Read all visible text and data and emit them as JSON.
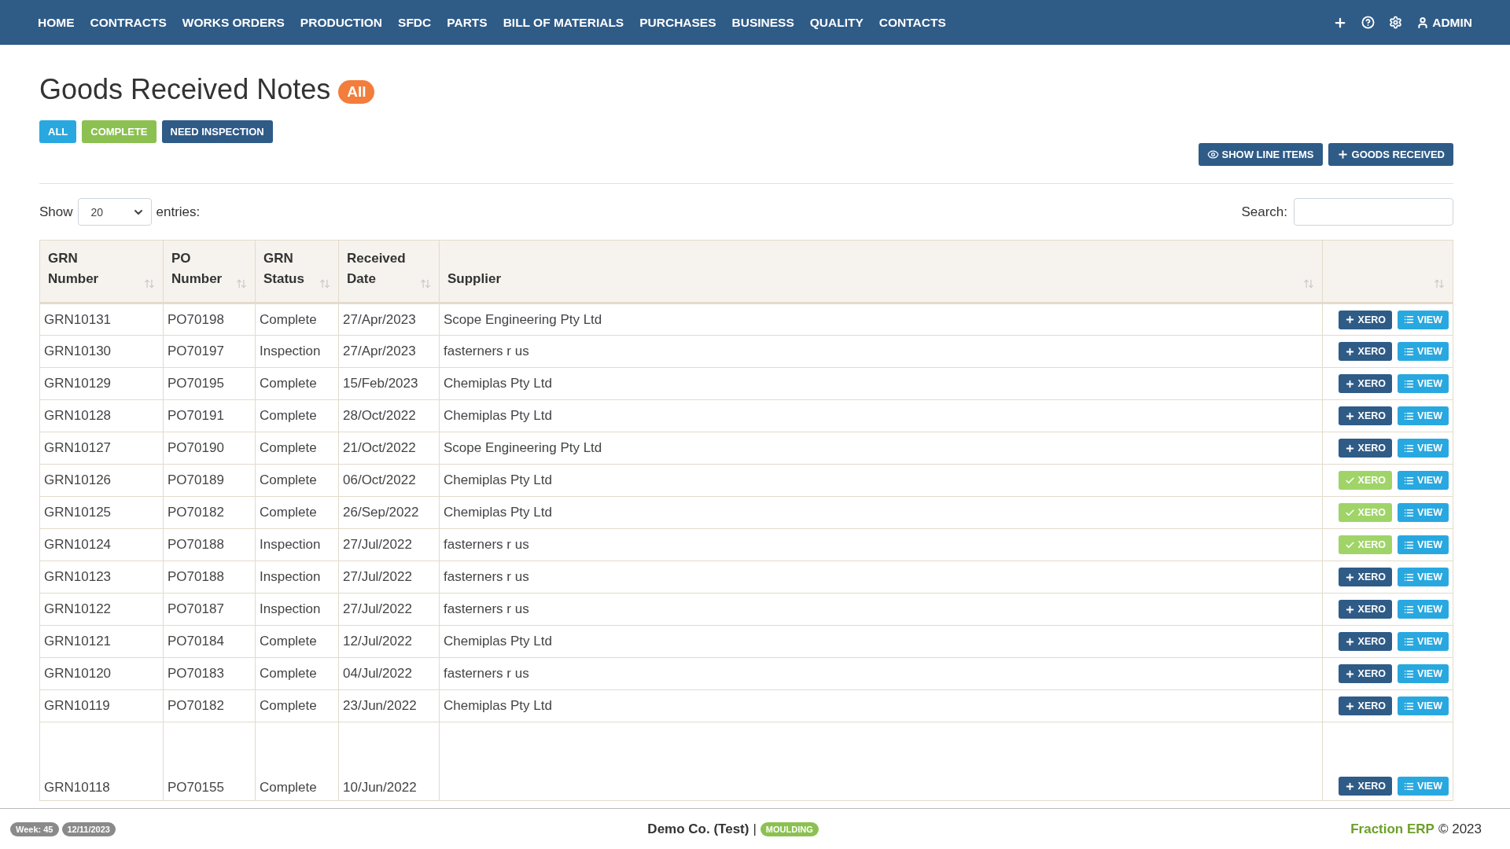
{
  "nav": {
    "items": [
      "HOME",
      "CONTRACTS",
      "WORKS ORDERS",
      "PRODUCTION",
      "SFDC",
      "PARTS",
      "BILL OF MATERIALS",
      "PURCHASES",
      "BUSINESS",
      "QUALITY",
      "CONTACTS"
    ],
    "user": "ADMIN"
  },
  "title": "Goods Received Notes",
  "title_badge": "All",
  "filters": [
    {
      "label": "ALL",
      "color": "#29a8e0"
    },
    {
      "label": "COMPLETE",
      "color": "#8cc152"
    },
    {
      "label": "NEED INSPECTION",
      "color": "#2f5b87"
    }
  ],
  "actions": [
    {
      "label": "SHOW LINE ITEMS",
      "kind": "eye"
    },
    {
      "label": "GOODS RECEIVED",
      "kind": "plus"
    }
  ],
  "length": {
    "before": "Show",
    "value": "20",
    "after": "entries:"
  },
  "search": {
    "label": "Search:"
  },
  "table": {
    "columns": [
      "GRN Number",
      "PO Number",
      "GRN Status",
      "Received Date",
      "Supplier"
    ],
    "rows": [
      {
        "grn": "GRN10131",
        "po": "PO70198",
        "status": "Complete",
        "date": "27/Apr/2023",
        "supplier": "Scope Engineering Pty Ltd",
        "xero": {
          "label": "XERO",
          "exported": false
        },
        "view": "VIEW"
      },
      {
        "grn": "GRN10130",
        "po": "PO70197",
        "status": "Inspection",
        "date": "27/Apr/2023",
        "supplier": "fasterners r us",
        "xero": {
          "label": "XERO",
          "exported": false
        },
        "view": "VIEW"
      },
      {
        "grn": "GRN10129",
        "po": "PO70195",
        "status": "Complete",
        "date": "15/Feb/2023",
        "supplier": "Chemiplas Pty Ltd",
        "xero": {
          "label": "XERO",
          "exported": false
        },
        "view": "VIEW"
      },
      {
        "grn": "GRN10128",
        "po": "PO70191",
        "status": "Complete",
        "date": "28/Oct/2022",
        "supplier": "Chemiplas Pty Ltd",
        "xero": {
          "label": "XERO",
          "exported": false
        },
        "view": "VIEW"
      },
      {
        "grn": "GRN10127",
        "po": "PO70190",
        "status": "Complete",
        "date": "21/Oct/2022",
        "supplier": "Scope Engineering Pty Ltd",
        "xero": {
          "label": "XERO",
          "exported": false
        },
        "view": "VIEW"
      },
      {
        "grn": "GRN10126",
        "po": "PO70189",
        "status": "Complete",
        "date": "06/Oct/2022",
        "supplier": "Chemiplas Pty Ltd",
        "xero": {
          "label": "XERO",
          "exported": true
        },
        "view": "VIEW"
      },
      {
        "grn": "GRN10125",
        "po": "PO70182",
        "status": "Complete",
        "date": "26/Sep/2022",
        "supplier": "Chemiplas Pty Ltd",
        "xero": {
          "label": "XERO",
          "exported": true
        },
        "view": "VIEW"
      },
      {
        "grn": "GRN10124",
        "po": "PO70188",
        "status": "Inspection",
        "date": "27/Jul/2022",
        "supplier": "fasterners r us",
        "xero": {
          "label": "XERO",
          "exported": true
        },
        "view": "VIEW"
      },
      {
        "grn": "GRN10123",
        "po": "PO70188",
        "status": "Inspection",
        "date": "27/Jul/2022",
        "supplier": "fasterners r us",
        "xero": {
          "label": "XERO",
          "exported": false
        },
        "view": "VIEW"
      },
      {
        "grn": "GRN10122",
        "po": "PO70187",
        "status": "Inspection",
        "date": "27/Jul/2022",
        "supplier": "fasterners r us",
        "xero": {
          "label": "XERO",
          "exported": false
        },
        "view": "VIEW"
      },
      {
        "grn": "GRN10121",
        "po": "PO70184",
        "status": "Complete",
        "date": "12/Jul/2022",
        "supplier": "Chemiplas Pty Ltd",
        "xero": {
          "label": "XERO",
          "exported": false
        },
        "view": "VIEW"
      },
      {
        "grn": "GRN10120",
        "po": "PO70183",
        "status": "Complete",
        "date": "04/Jul/2022",
        "supplier": "fasterners r us",
        "xero": {
          "label": "XERO",
          "exported": false
        },
        "view": "VIEW"
      },
      {
        "grn": "GRN10119",
        "po": "PO70182",
        "status": "Complete",
        "date": "23/Jun/2022",
        "supplier": "Chemiplas Pty Ltd",
        "xero": {
          "label": "XERO",
          "exported": false
        },
        "view": "VIEW"
      },
      {
        "grn": "GRN10118",
        "po": "PO70155",
        "status": "Complete",
        "date": "10/Jun/2022",
        "supplier": "",
        "xero": {
          "label": "XERO",
          "exported": false
        },
        "view": "VIEW"
      }
    ]
  },
  "footer": {
    "week": "Week: 45",
    "date": "12/11/2023",
    "company": "Demo Co. (Test)",
    "separator": "|",
    "module": "MOULDING",
    "brand": "Fraction ERP",
    "copyright": "© 2023"
  }
}
